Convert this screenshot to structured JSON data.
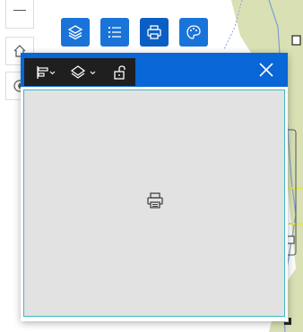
{
  "toolbar": {
    "buttons": [
      {
        "name": "layers-button",
        "icon": "layers-icon"
      },
      {
        "name": "legend-button",
        "icon": "list-icon"
      },
      {
        "name": "print-button",
        "icon": "printer-icon",
        "active": true
      },
      {
        "name": "basemap-button",
        "icon": "palette-icon"
      }
    ]
  },
  "nav": {
    "zoom_out": "—",
    "home_icon": "home-icon",
    "compass_icon": "compass-icon"
  },
  "panel": {
    "title": "",
    "body_icon": "printer-icon",
    "mini_toolbar": [
      {
        "name": "align-icon",
        "has_dropdown": true
      },
      {
        "name": "layers-icon",
        "has_dropdown": true
      },
      {
        "name": "unlock-icon",
        "has_dropdown": false
      }
    ]
  },
  "colors": {
    "accent": "#1a73d9",
    "header": "#0866d6",
    "panel_border": "#3fb8c3",
    "map_green": "#d6dfb0"
  }
}
